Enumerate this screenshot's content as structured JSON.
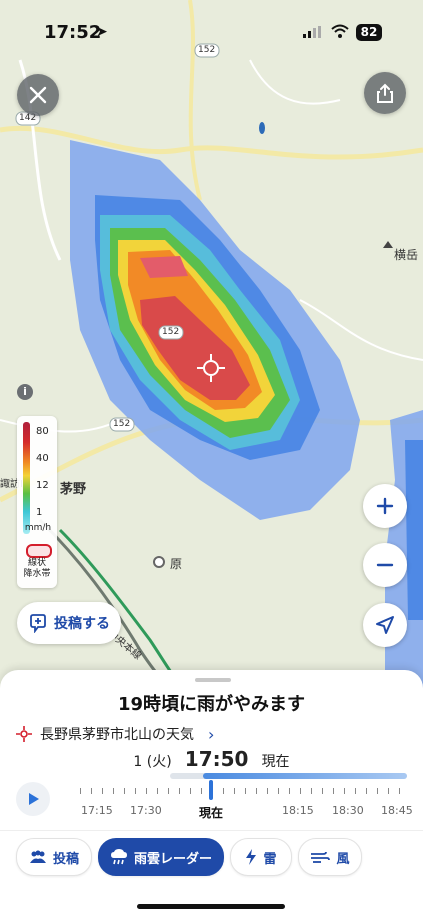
{
  "status_bar": {
    "time": "17:52",
    "battery": "82"
  },
  "map": {
    "road_labels": [
      "142",
      "152",
      "152",
      "152"
    ],
    "place_labels": {
      "yokodake": "横岳",
      "chino": "茅野",
      "hara": "原",
      "chino_ic": "諏訪IC",
      "expressway": "中央本線"
    },
    "legend": {
      "values": [
        "80",
        "40",
        "12",
        "1"
      ],
      "unit": "mm/h",
      "band_label_1": "線状",
      "band_label_2": "降水帯"
    },
    "colors": {
      "accent": "#1f4aa8",
      "rain_heavy": "#d42b2b",
      "rain_mid": "#f3d336",
      "rain_light": "#3ec7d6"
    }
  },
  "buttons": {
    "post_label": "投稿する"
  },
  "sheet": {
    "headline": "19時頃に雨がやみます",
    "location": "長野県茅野市北山の天気",
    "day": "1 (火)",
    "time": "17:50",
    "now_label": "現在",
    "timeline_labels": [
      "17:15",
      "17:30",
      "現在",
      "18:15",
      "18:30",
      "18:45"
    ]
  },
  "tabs": [
    {
      "label": "投稿",
      "icon": "people-icon"
    },
    {
      "label": "雨雲レーダー",
      "icon": "rain-cloud-icon"
    },
    {
      "label": "雷",
      "icon": "lightning-icon"
    },
    {
      "label": "風",
      "icon": "wind-icon"
    }
  ]
}
